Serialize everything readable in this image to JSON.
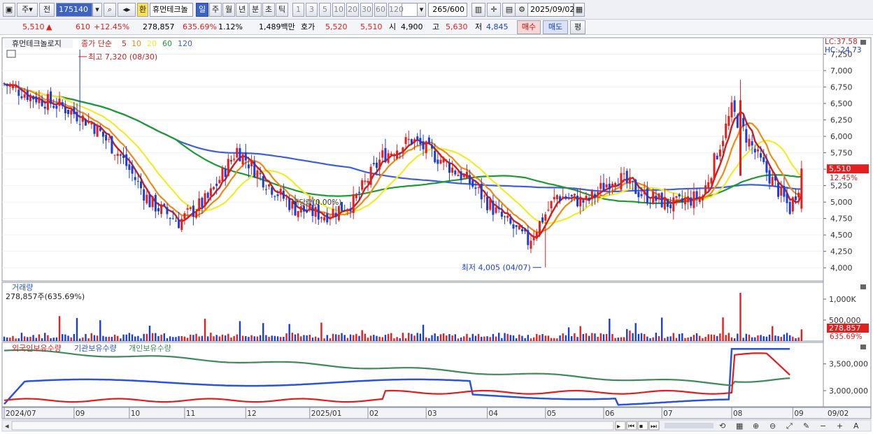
{
  "toolbar": {
    "market_sel": "주",
    "prev_label": "전",
    "stock_code": "175140",
    "won_badge": "환",
    "stock_name": "휴먼테크놀",
    "periods": [
      "일",
      "주",
      "월",
      "년",
      "분",
      "초",
      "틱"
    ],
    "period_active": "일",
    "intervals": [
      "1",
      "3",
      "5",
      "10",
      "20",
      "30",
      "60",
      "120"
    ],
    "count": "265",
    "count_total": "/600",
    "date": "2025/09/02"
  },
  "quote": {
    "price": "5,510",
    "arrow": "▲",
    "change": "610",
    "change_pct": "+12.45%",
    "volume": "278,857",
    "volume_ratio": "635.69%",
    "turnover": "1.12%",
    "amount": "1,489백만",
    "ask_label": "호가",
    "ask_val": "5,520",
    "bid_val": "5,510",
    "open_label": "시",
    "open_val": "4,900",
    "high_label": "고",
    "high_val": "5,630",
    "low_label": "저",
    "low_val": "4,845",
    "buy_label": "매수",
    "sell_label": "매도",
    "eval_label": "평"
  },
  "colors": {
    "up": "#e32020",
    "down": "#1b3fd6",
    "ma5": "#d11c1c",
    "ma10": "#ef8a12",
    "ma20": "#f2ec28",
    "ma60": "#1f9a33",
    "ma120": "#3b5fe0",
    "foreign": "#e11d1d",
    "inst": "#2a53dc",
    "indiv": "#3d8a5c"
  },
  "chart_data": [
    {
      "type": "candlestick",
      "title": "휴먼테크놀로지",
      "ma_legend": {
        "label": "종가 단순",
        "periods": [
          "5",
          "10",
          "20",
          "60",
          "120"
        ]
      },
      "ylim": [
        3800,
        7500
      ],
      "yticks": [
        "7,250",
        "7,000",
        "6,750",
        "6,500",
        "6,250",
        "6,000",
        "5,750",
        "5,500",
        "5,250",
        "5,000",
        "4,750",
        "4,500",
        "4,250",
        "4,000"
      ],
      "lc": "LC:37.58",
      "hc": "HC:-24.73",
      "last_price": "5,510",
      "last_pct": "12.45%",
      "high_note": "최고 7,320 (08/30)",
      "low_note": "최저 4,005 (04/07)",
      "dividend_note": "배당락(0.00%)",
      "xlabels": [
        "2024/07",
        "09",
        "10",
        "11",
        "12",
        "2025/01",
        "02",
        "03",
        "04",
        "05",
        "06",
        "07",
        "08",
        "09"
      ],
      "last_xlabel": "09/02",
      "price_path": [
        [
          0,
          6800
        ],
        [
          10,
          6600
        ],
        [
          20,
          6450
        ],
        [
          30,
          6200
        ],
        [
          40,
          5700
        ],
        [
          50,
          5000
        ],
        [
          60,
          4700
        ],
        [
          70,
          5050
        ],
        [
          80,
          5800
        ],
        [
          90,
          5300
        ],
        [
          100,
          4900
        ],
        [
          110,
          4800
        ],
        [
          120,
          5000
        ],
        [
          130,
          5700
        ],
        [
          140,
          5950
        ],
        [
          150,
          5650
        ],
        [
          160,
          5300
        ],
        [
          170,
          4800
        ],
        [
          180,
          4400
        ],
        [
          190,
          5100
        ],
        [
          200,
          5000
        ],
        [
          210,
          5400
        ],
        [
          220,
          5100
        ],
        [
          230,
          4950
        ],
        [
          240,
          5100
        ],
        [
          250,
          6400
        ],
        [
          260,
          5600
        ],
        [
          265,
          5250
        ],
        [
          270,
          4900
        ],
        [
          275,
          5510
        ]
      ]
    },
    {
      "type": "bar",
      "title": "거래량",
      "current": "278,857주(635.69%)",
      "yticks": [
        "1,000K",
        "500,000"
      ],
      "last_value": "278,857",
      "last_pct": "635.69%"
    },
    {
      "type": "line",
      "series": [
        {
          "name": "외국인보유수량"
        },
        {
          "name": "기관보유수량"
        },
        {
          "name": "개인보유수량"
        }
      ],
      "yticks": [
        "3,500,000",
        "3,000,000"
      ]
    }
  ]
}
